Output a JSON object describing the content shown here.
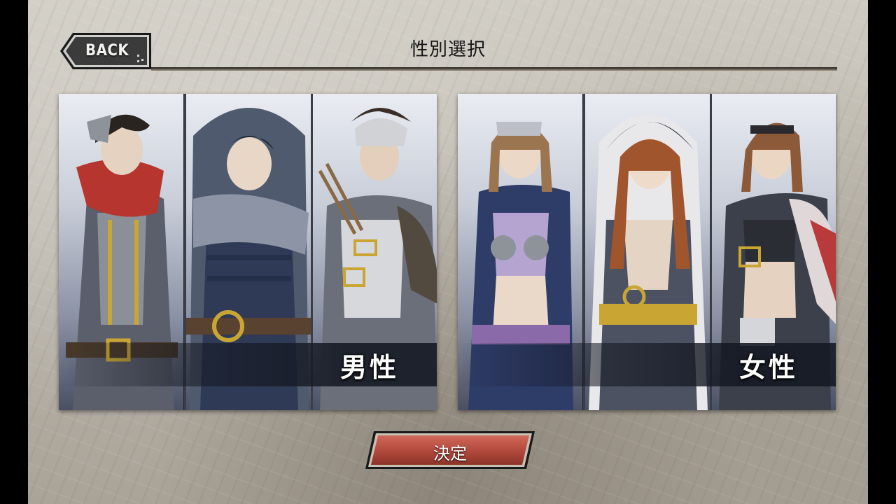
{
  "header": {
    "back_label": "BACK",
    "title": "性別選択"
  },
  "panels": [
    {
      "id": "male",
      "label": "男性"
    },
    {
      "id": "female",
      "label": "女性"
    }
  ],
  "confirm_label": "決定",
  "colors": {
    "panel_label": "#ffffff",
    "confirm_button": "#b54a3e",
    "back_button": "#3a3a3a"
  }
}
